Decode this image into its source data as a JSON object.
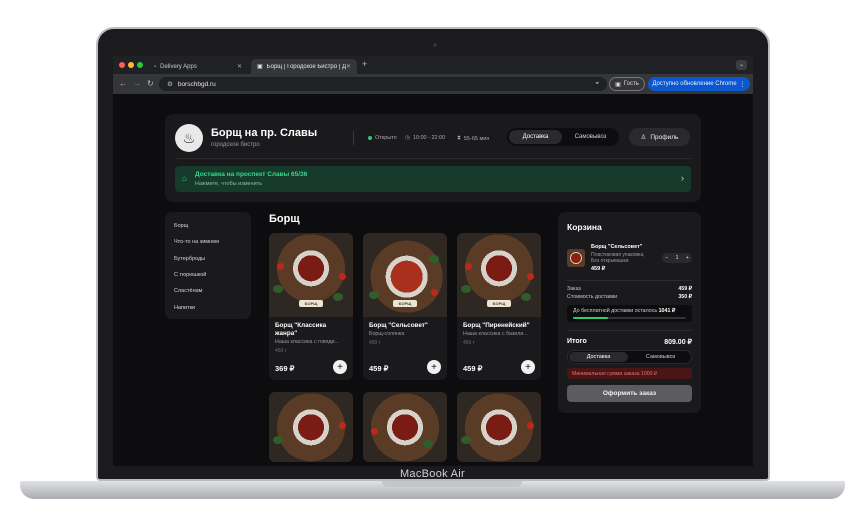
{
  "device": {
    "label": "MacBook Air"
  },
  "browser": {
    "tabs": [
      {
        "title": "Delivery Apps",
        "active": false
      },
      {
        "title": "Борщ | Городское Бистро | Д",
        "active": true
      }
    ],
    "url": "borschbgd.ru",
    "guest_label": "Гость",
    "update_label": "Доступно обновление Chrome",
    "icons": [
      "back-icon",
      "forward-icon",
      "reload-icon",
      "site-info-icon",
      "location-icon",
      "guest-icon",
      "menu-dots-icon"
    ]
  },
  "header": {
    "title": "Борщ на пр. Славы",
    "subtitle": "городское бистро",
    "status": "Открыто",
    "hours": "10:00 - 22:00",
    "eta": "55-65 мин",
    "mode_options": [
      "Доставка",
      "Самовывоз"
    ],
    "profile_label": "Профиль",
    "status_color": "#2ecc71"
  },
  "delivery": {
    "title": "Доставка на проспект Славы 65/36",
    "subtitle": "Нажмите, чтобы изменить",
    "accent": "#39d98a"
  },
  "sidebar": {
    "items": [
      "Борщ",
      "Что-то на зимнем",
      "Бутерброды",
      "С тюрюшкой",
      "Сластёнам",
      "Напитки"
    ]
  },
  "menu": {
    "section_title": "Борщ",
    "add_label": "+",
    "items": [
      {
        "name": "Борщ \"Классика жанра\"",
        "desc": "Наша классика с говяди...",
        "weight": "450 г",
        "price": "369 ₽"
      },
      {
        "name": "Борщ \"Сельсовет\"",
        "desc": "Борщ-солянка",
        "weight": "450 г",
        "price": "459 ₽"
      },
      {
        "name": "Борщ \"Пиренейский\"",
        "desc": "Наша классика с базили...",
        "weight": "450 г",
        "price": "459 ₽"
      }
    ],
    "photo_tag": "БОРЩ"
  },
  "cart": {
    "title": "Корзина",
    "item": {
      "name": "Борщ \"Сельсовет\"",
      "desc": "Пластиковая упаковка, Без открывашки",
      "price": "459 ₽",
      "qty": "1",
      "minus": "−",
      "plus": "+"
    },
    "order_label": "Заказ",
    "order_value": "459 ₽",
    "delivery_label": "Стоимость доставки",
    "delivery_value": "350 ₽",
    "free_label": "До бесплатной доставки осталось",
    "free_value": "1041 ₽",
    "free_progress": 0.31,
    "total_label": "Итого",
    "total_value": "809.00 ₽",
    "mode_options": [
      "Доставка",
      "Самовывоз"
    ],
    "warning": "Минимальная сумма заказа 1000 ₽",
    "submit_label": "Оформить заказ"
  }
}
